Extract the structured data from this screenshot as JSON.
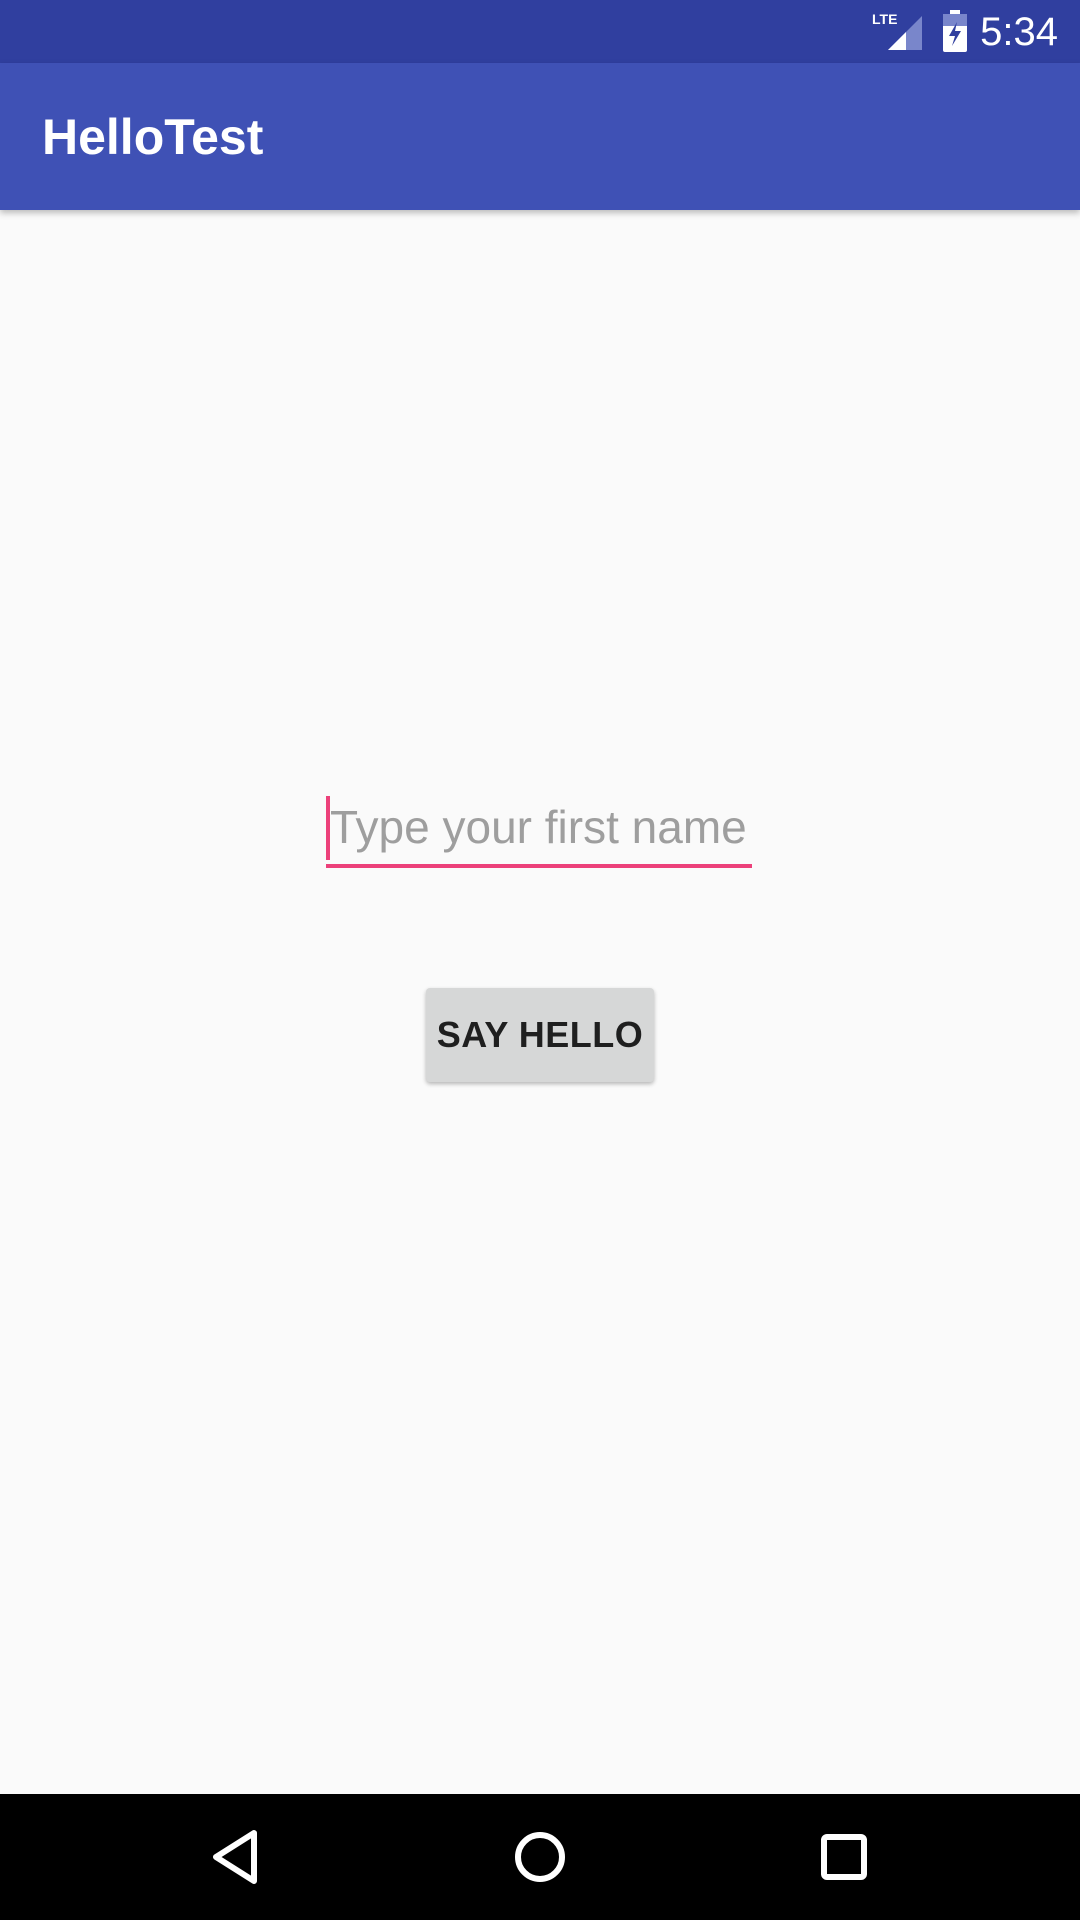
{
  "status_bar": {
    "time": "5:34",
    "network_label": "LTE",
    "network_icon": "lte-signal-icon",
    "battery_icon": "battery-charging-icon",
    "background_color": "#303F9F"
  },
  "app_bar": {
    "title": "HelloTest",
    "background_color": "#3F51B5"
  },
  "main": {
    "name_input": {
      "value": "",
      "placeholder": "Type your first name",
      "accent_color": "#EC407A"
    },
    "say_hello_button": {
      "label": "SAY HELLO"
    }
  },
  "nav_bar": {
    "back_icon": "back-icon",
    "home_icon": "home-icon",
    "recents_icon": "recents-icon"
  }
}
